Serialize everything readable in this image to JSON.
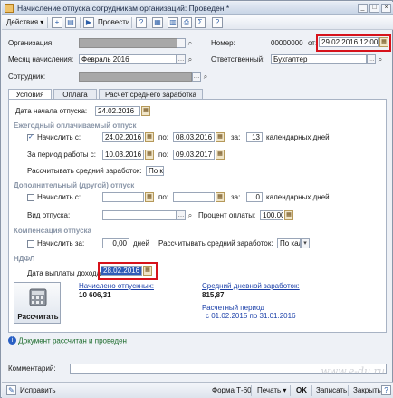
{
  "window": {
    "title": "Начисление отпуска сотрудникам организаций: Проведен *",
    "buttons": {
      "minimize": "_",
      "maximize": "□",
      "close": "×"
    }
  },
  "toolbar": {
    "actions_label": "Действия ▾",
    "post_label": "Провести",
    "icons": [
      "add-icon",
      "copy-icon",
      "post-icon",
      "help-icon",
      "doc-icon",
      "doc2-icon",
      "print-icon",
      "calc-icon",
      "help2-icon"
    ]
  },
  "header": {
    "organization_label": "Организация:",
    "number_label": "Номер:",
    "number_value": "00000000",
    "from_label": "от:",
    "date_value": "29.02.2016 12:00",
    "month_label": "Месяц начисления:",
    "month_value": "Февраль 2016",
    "responsible_label": "Ответственный:",
    "responsible_value": "Бухгалтер",
    "employee_label": "Сотрудник:"
  },
  "tabs": [
    {
      "label": "Условия"
    },
    {
      "label": "Оплата"
    },
    {
      "label": "Расчет среднего заработка"
    }
  ],
  "conditions": {
    "vacation_start_label": "Дата начала отпуска:",
    "vacation_start_value": "24.02.2016",
    "annual_section": "Ежегодный оплачиваемый отпуск",
    "accrue_from_label": "Начислить с:",
    "accrue_from_value": "24.02.2016",
    "to_label": "по:",
    "to_value": "08.03.2016",
    "for_label": "за:",
    "days_value": "13",
    "calendar_days_label": "календарных дней",
    "period_label": "За период работы с:",
    "period_from_value": "10.03.2016",
    "period_to_value": "09.03.2017",
    "avg_earnings_label": "Рассчитывать средний заработок:",
    "avg_earnings_value": "По к",
    "additional_section": "Дополнительный (другой) отпуск",
    "add_from_label": "Начислить с:",
    "add_from_value": " .  .",
    "add_to_value": " .  .",
    "add_days_value": "0",
    "vacation_type_label": "Вид отпуска:",
    "payment_percent_label": "Процент оплаты:",
    "payment_percent_value": "100,00",
    "compensation_section": "Компенсация отпуска",
    "comp_accrue_label": "Начислить за:",
    "comp_days_value": "0,00",
    "comp_days_label": "дней",
    "comp_avg_label": "Рассчитывать средний заработок:",
    "comp_avg_value": "По кал",
    "ndfl_section": "НДФЛ",
    "income_date_label": "Дата выплаты дохода:",
    "income_date_value": "28.02.2016",
    "calc_button_label": "Рассчитать",
    "accrued_label": "Начислено отпускных:",
    "accrued_value": "10 606,31",
    "avg_daily_label": "Средний дневной заработок:",
    "avg_daily_value": "815,87",
    "calc_period_label": "Расчетный период",
    "calc_period_value": "с 01.02.2015 по 31.01.2016"
  },
  "status_text": "Документ рассчитан и проведен",
  "comment_label": "Комментарий:",
  "bottom": {
    "fix_label": "Исправить",
    "form_label": "Форма Т-60",
    "print_label": "Печать ▾",
    "ok_label": "OK",
    "save_label": "Записать",
    "close_label": "Закрыть"
  },
  "watermark": "www.e-du.ru",
  "colors": {
    "highlight_border": "#d6121b",
    "accent_blue": "#1a3fa8"
  }
}
